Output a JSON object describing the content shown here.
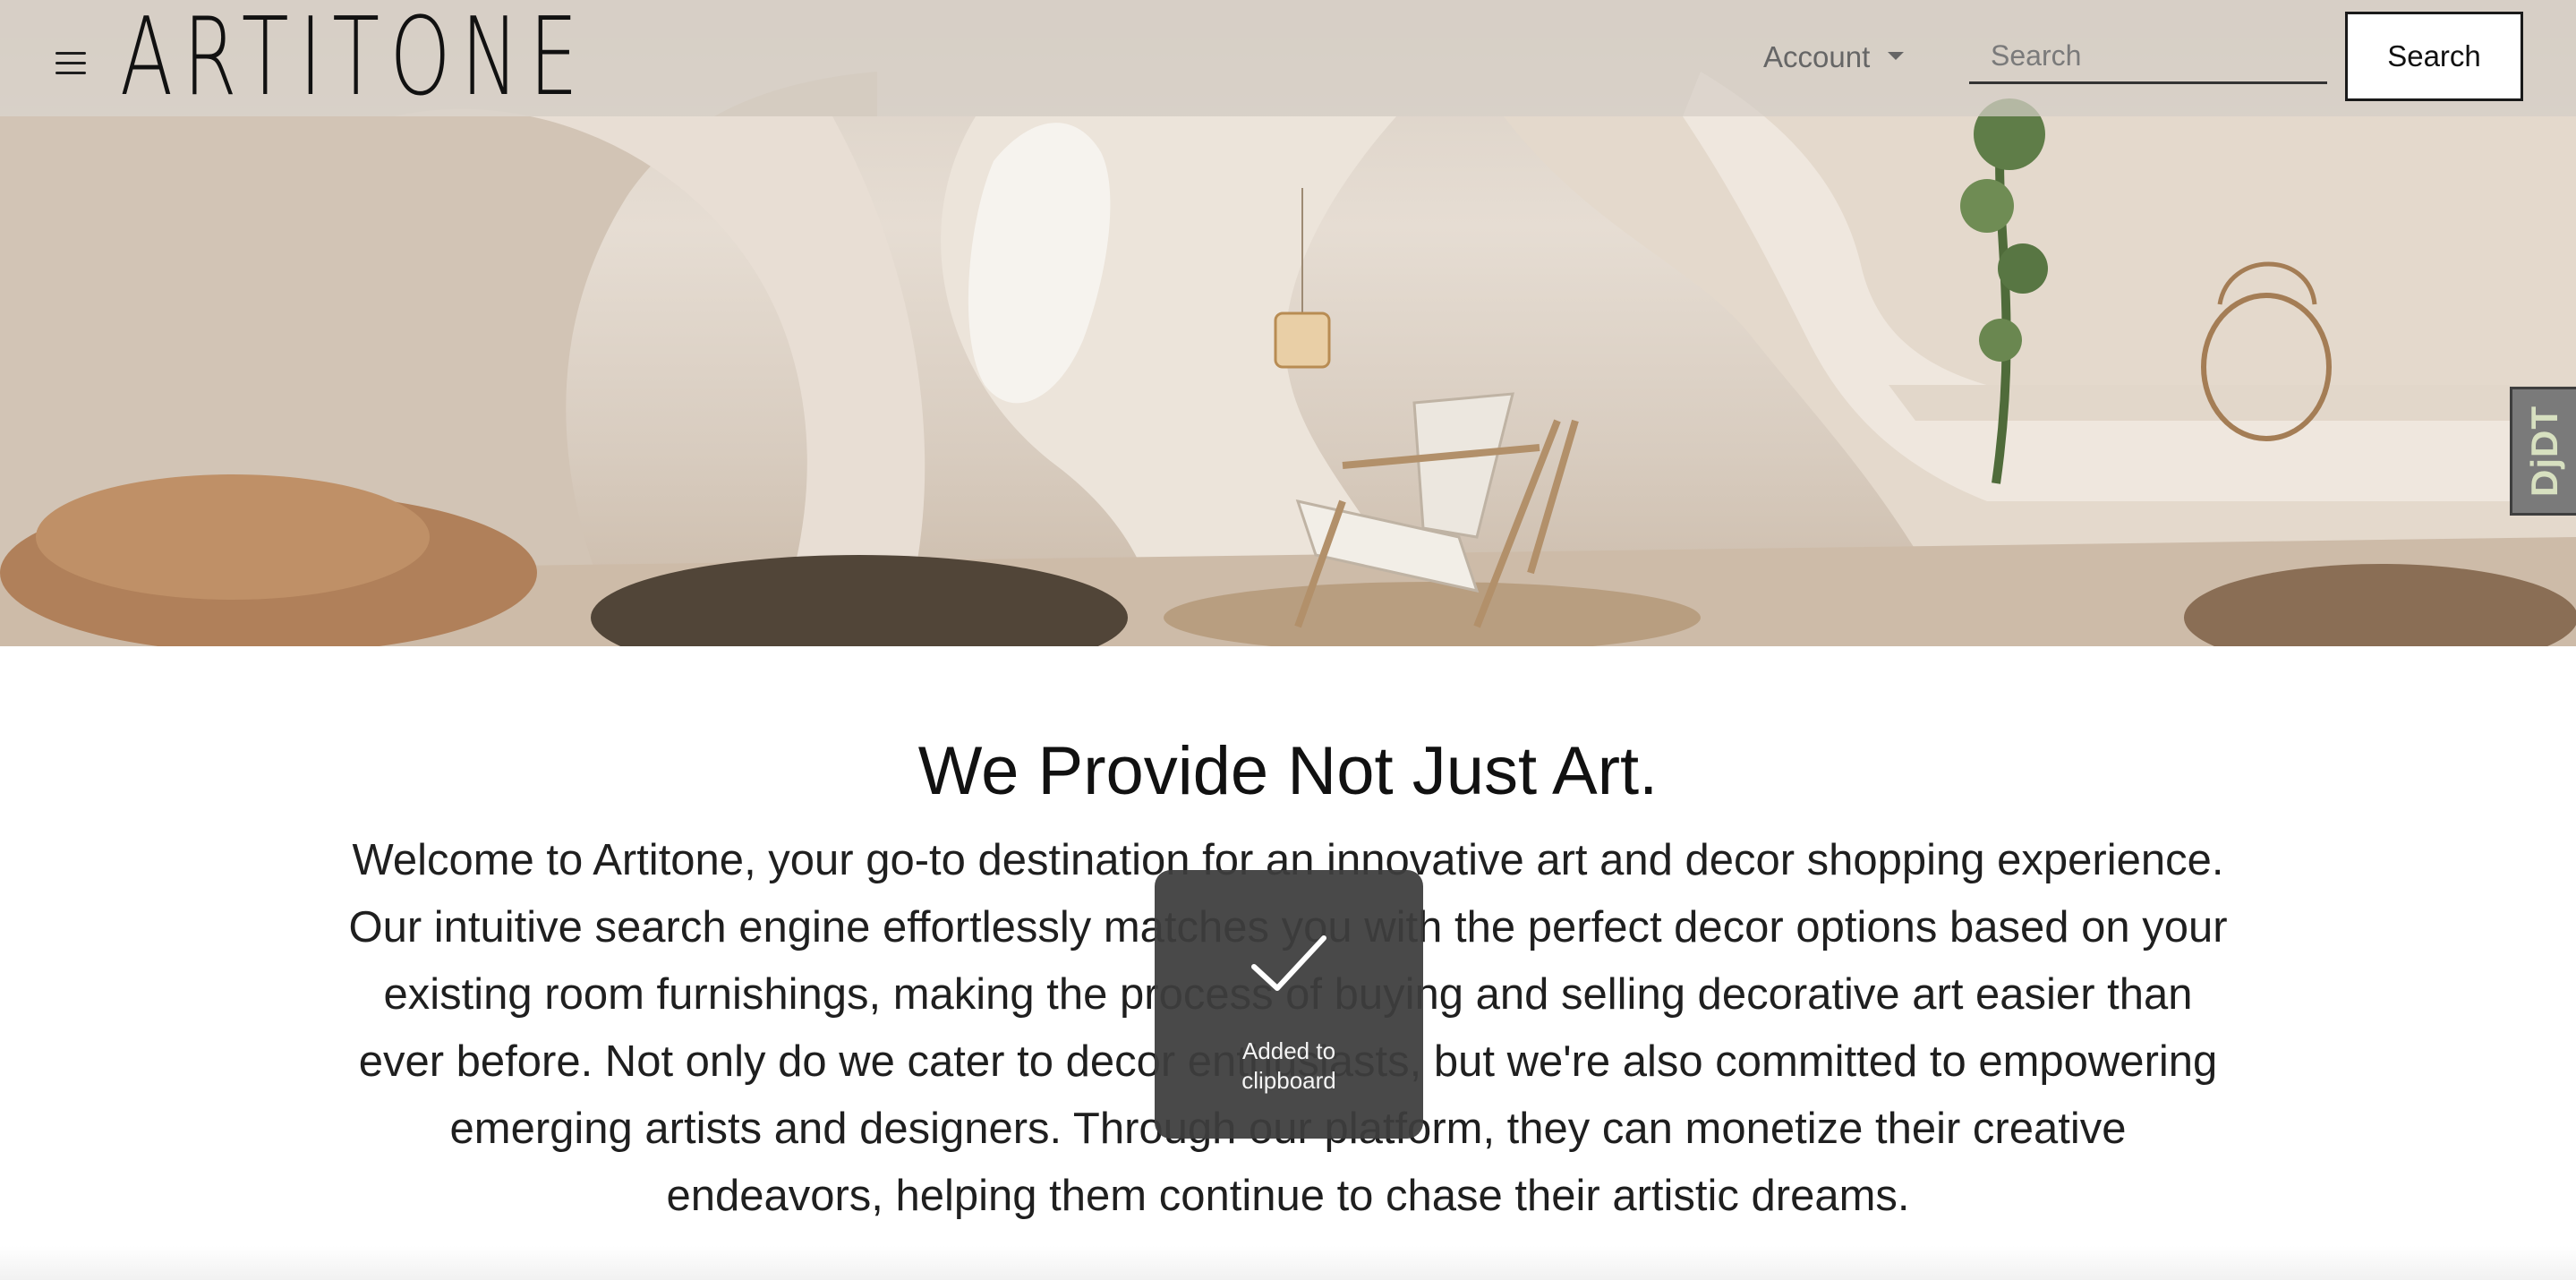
{
  "nav": {
    "logo_text": "ARTITONE",
    "menu_icon": "hamburger-menu-icon",
    "account_label": "Account",
    "account_icon": "caret-down-icon",
    "search_placeholder": "Search",
    "search_button_label": "Search"
  },
  "hero": {
    "description": "interior scene: curved plaster walls, lounge chair, pendant lamp, hanging plant, lantern, cushions"
  },
  "content": {
    "headline": "We Provide Not Just Art.",
    "intro": "Welcome to Artitone, your go-to destination for an innovative art and decor shopping experience. Our intuitive search engine effortlessly matches you with the perfect decor options based on your existing room furnishings, making the process of buying and selling decorative art easier than ever before. Not only do we cater to decor enthusiasts, but we're also committed to empowering emerging artists and designers. Through our platform, they can monetize their creative endeavors, helping them continue to chase their artistic dreams."
  },
  "toast": {
    "icon": "checkmark-icon",
    "label": "Added to clipboard"
  },
  "debug_toolbar": {
    "label": "DjDT"
  },
  "colors": {
    "navbar_overlay": "#d6cec6",
    "toast_background": "#3e3e3e",
    "text": "#1a1a1a",
    "account_text": "#666666"
  }
}
